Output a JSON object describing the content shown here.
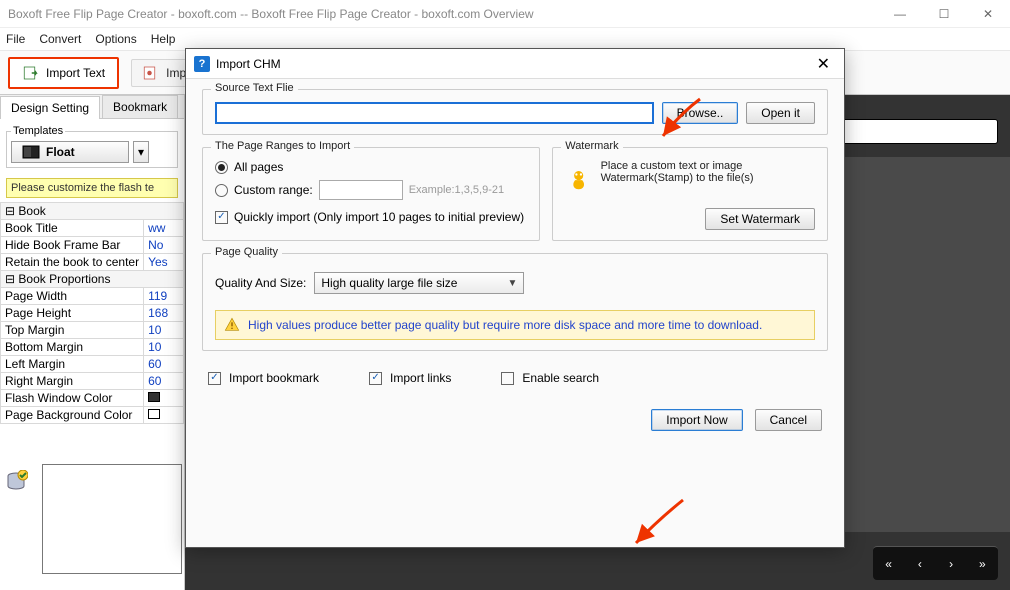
{
  "window": {
    "title": "Boxoft Free Flip Page Creator - boxoft.com -- Boxoft Free Flip Page Creator - boxoft.com Overview",
    "min": "—",
    "max": "☐",
    "close": "✕"
  },
  "menu": {
    "file": "File",
    "convert": "Convert",
    "options": "Options",
    "help": "Help"
  },
  "toolbar": {
    "import_text": "Import Text",
    "imp_cut": "Imp"
  },
  "left": {
    "tab_design": "Design Setting",
    "tab_bookmark": "Bookmark",
    "templates_label": "Templates",
    "float_label": "Float",
    "notice": "Please customize the flash te",
    "props": {
      "group1": "Book",
      "r1k": "Book Title",
      "r1v": "ww",
      "r2k": "Hide Book Frame Bar",
      "r2v": "No",
      "r3k": "Retain the book to center",
      "r3v": "Yes",
      "group2": "Book Proportions",
      "r4k": "Page Width",
      "r4v": "119",
      "r5k": "Page Height",
      "r5v": "168",
      "r6k": "Top Margin",
      "r6v": "10",
      "r7k": "Bottom Margin",
      "r7v": "10",
      "r8k": "Left Margin",
      "r8v": "60",
      "r9k": "Right Margin",
      "r9v": "60",
      "r10k": "Flash Window Color",
      "r10v": "",
      "r11k": "Page Background Color",
      "r11v": ""
    }
  },
  "dialog": {
    "title": "Import CHM",
    "source_label": "Source Text Flie",
    "browse": "Browse..",
    "open": "Open it",
    "ranges_label": "The Page Ranges to Import",
    "all_pages": "All pages",
    "custom_range": "Custom range:",
    "example": "Example:1,3,5,9-21",
    "quickly": "Quickly import (Only import 10 pages to  initial  preview)",
    "watermark_label": "Watermark",
    "watermark_text": "Place a custom text or image Watermark(Stamp) to the file(s)",
    "set_watermark": "Set Watermark",
    "quality_label": "Page Quality",
    "quality_and_size": "Quality And Size:",
    "quality_value": "High quality large file size",
    "info": "High values produce better page quality but require more disk space and more time to download.",
    "import_bookmark": "Import bookmark",
    "import_links": "Import links",
    "enable_search": "Enable search",
    "import_now": "Import Now",
    "cancel": "Cancel"
  },
  "viewer": {
    "search_placeholder": ""
  }
}
